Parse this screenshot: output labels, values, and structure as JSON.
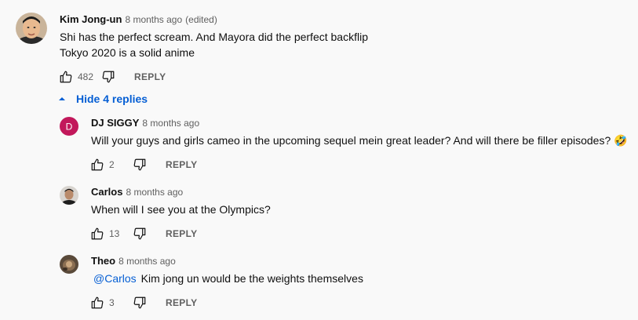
{
  "top_comment": {
    "author": "Kim Jong-un",
    "time": "8 months ago",
    "edited": "(edited)",
    "lines": [
      "Shi has the perfect scream. And Mayora did the perfect backflip",
      "Tokyo 2020 is a solid anime"
    ],
    "likes": "482",
    "reply_label": "REPLY"
  },
  "replies_toggle": {
    "label": "Hide 4 replies",
    "icon": "caret-up-icon"
  },
  "replies": [
    {
      "author": "DJ SIGGY",
      "time": "8 months ago",
      "avatar_letter": "D",
      "avatar_color": "#c2185b",
      "text": "Will your guys and girls cameo in the upcoming sequel mein great leader? And will there be filler episodes? 🤣",
      "likes": "2",
      "reply_label": "REPLY"
    },
    {
      "author": "Carlos",
      "time": "8 months ago",
      "text": "When will I see you at the Olympics?",
      "likes": "13",
      "reply_label": "REPLY"
    },
    {
      "author": "Theo",
      "time": "8 months ago",
      "mention": "@Carlos",
      "text": "Kim jong un would be the weights themselves",
      "likes": "3",
      "reply_label": "REPLY"
    }
  ],
  "colors": {
    "link": "#065fd4",
    "secondary_text": "#606060",
    "background": "#f9f9f9"
  }
}
